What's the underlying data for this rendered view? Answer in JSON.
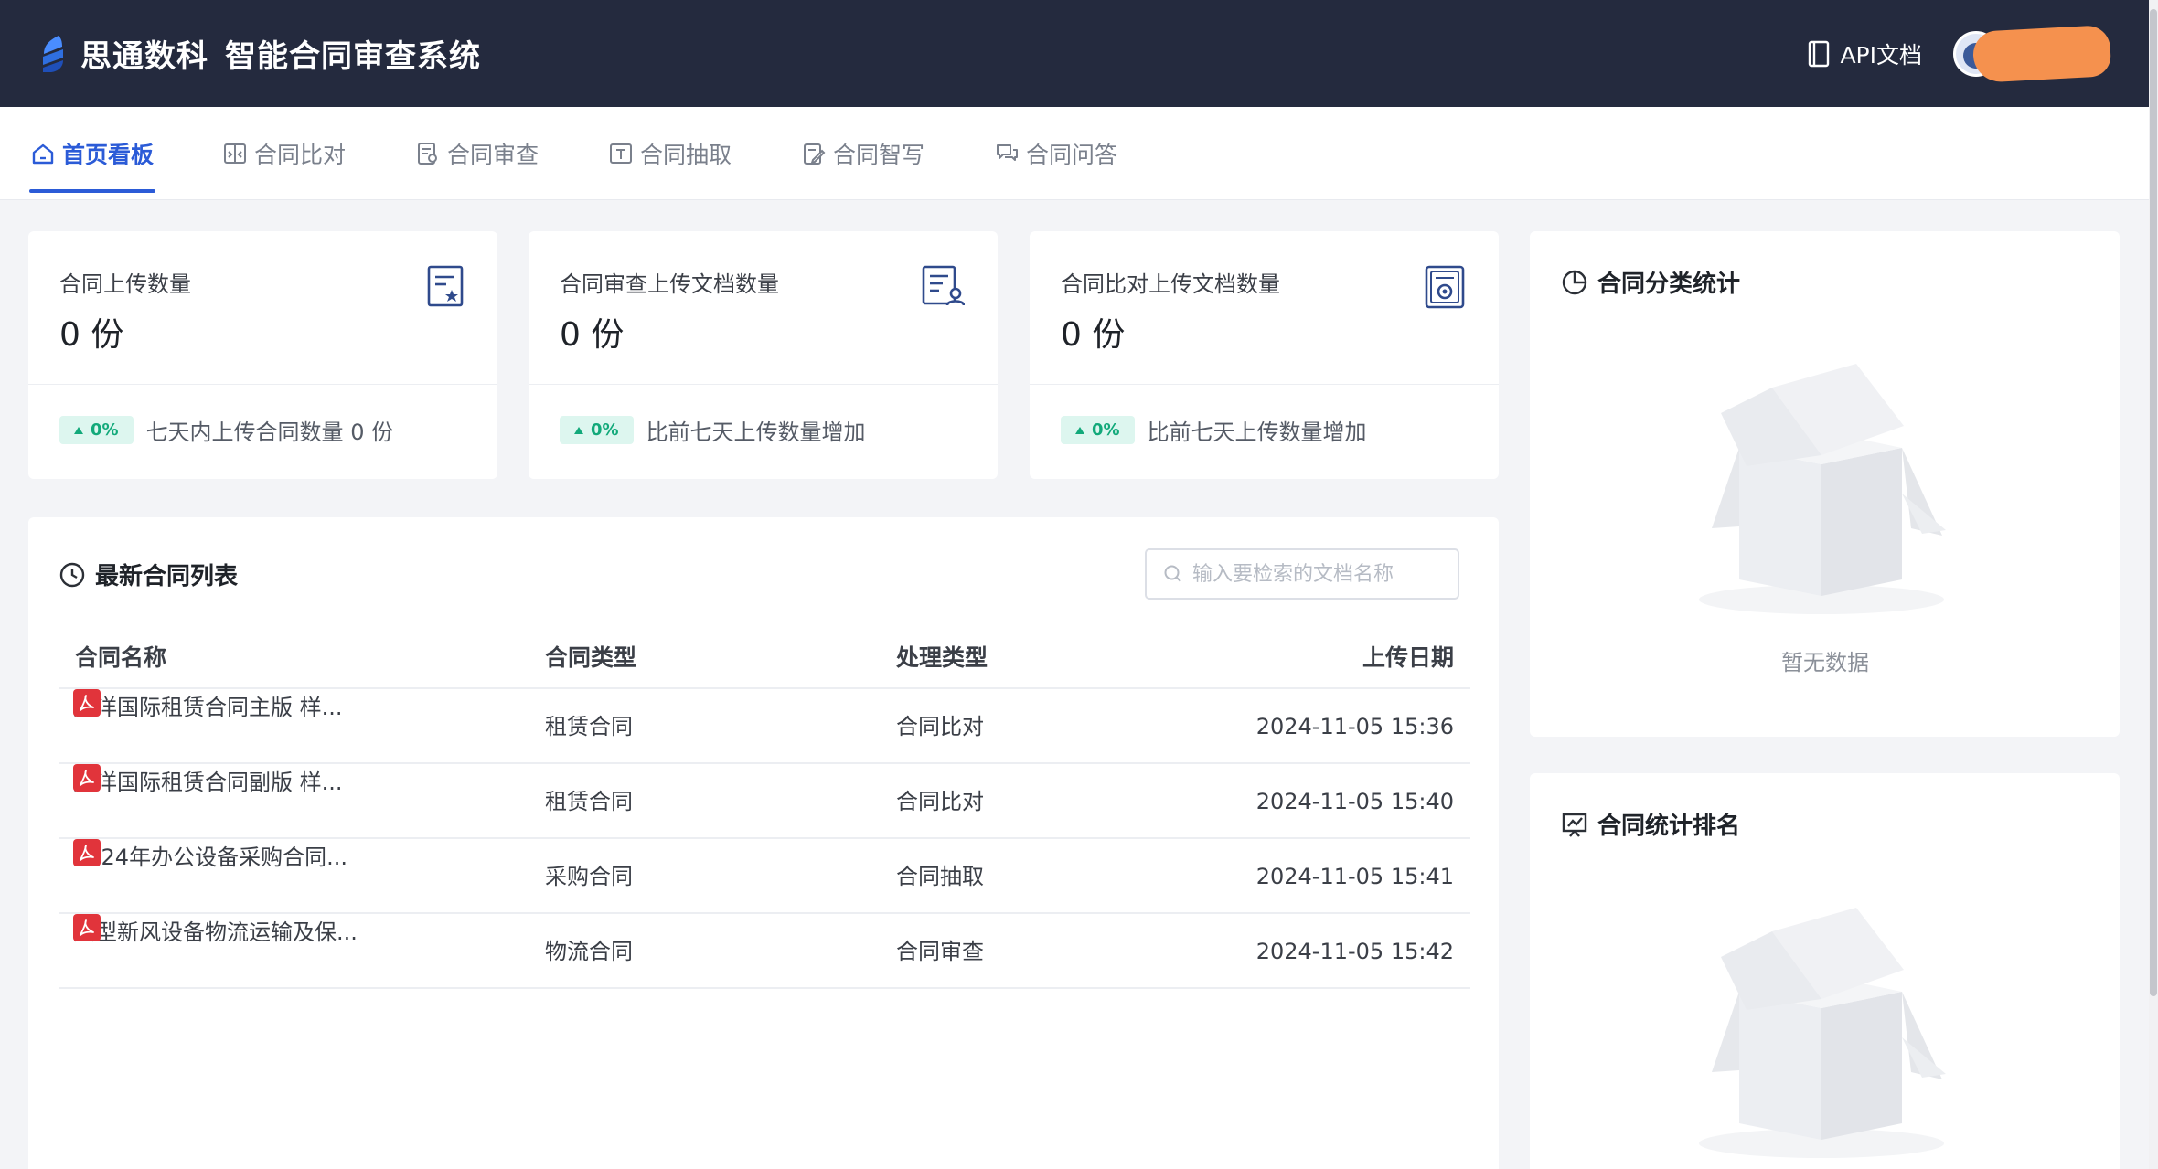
{
  "header": {
    "brand_name": "思通数科",
    "system_title": "智能合同审查系统",
    "api_label": "API文档"
  },
  "nav": {
    "tabs": [
      {
        "label": "首页看板",
        "active": true
      },
      {
        "label": "合同比对",
        "active": false
      },
      {
        "label": "合同审查",
        "active": false
      },
      {
        "label": "合同抽取",
        "active": false
      },
      {
        "label": "合同智写",
        "active": false
      },
      {
        "label": "合同问答",
        "active": false
      }
    ]
  },
  "stats": [
    {
      "label": "合同上传数量",
      "value": "0 份",
      "trend": "0%",
      "note": "七天内上传合同数量 0 份"
    },
    {
      "label": "合同审查上传文档数量",
      "value": "0 份",
      "trend": "0%",
      "note": "比前七天上传数量增加"
    },
    {
      "label": "合同比对上传文档数量",
      "value": "0 份",
      "trend": "0%",
      "note": "比前七天上传数量增加"
    }
  ],
  "latest": {
    "title": "最新合同列表",
    "search_placeholder": "输入要检索的文档名称",
    "columns": [
      "合同名称",
      "合同类型",
      "处理类型",
      "上传日期"
    ],
    "rows": [
      {
        "name": "远洋国际租赁合同主版 样...",
        "type": "租赁合同",
        "process": "合同比对",
        "date": "2024-11-05 15:36"
      },
      {
        "name": "远洋国际租赁合同副版 样...",
        "type": "租赁合同",
        "process": "合同比对",
        "date": "2024-11-05 15:40"
      },
      {
        "name": "2024年办公设备采购合同...",
        "type": "采购合同",
        "process": "合同抽取",
        "date": "2024-11-05 15:41"
      },
      {
        "name": "大型新风设备物流运输及保...",
        "type": "物流合同",
        "process": "合同审查",
        "date": "2024-11-05 15:42"
      }
    ]
  },
  "category_panel": {
    "title": "合同分类统计",
    "empty_text": "暂无数据"
  },
  "ranking_panel": {
    "title": "合同统计排名"
  },
  "colors": {
    "accent": "#2b5bd7",
    "header_bg": "#242a3e",
    "trend_green": "#12a97a",
    "pdf_red": "#e1343b"
  }
}
